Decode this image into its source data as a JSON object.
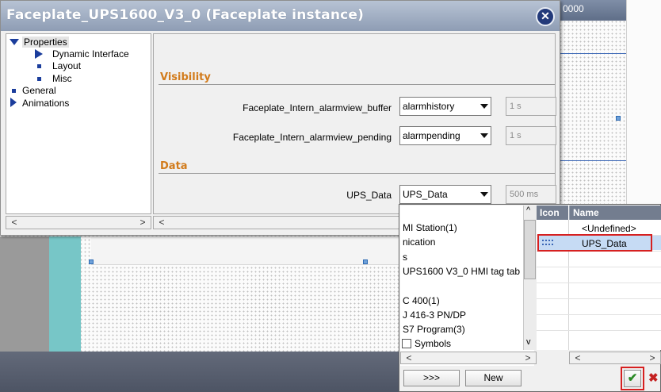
{
  "background": {
    "topright_value": "0000"
  },
  "dialog": {
    "title": "Faceplate_UPS1600_V3_0 (Faceplate instance)",
    "close_icon": "close-x-icon",
    "tree": {
      "properties": "Properties",
      "dynamic_interface": "Dynamic Interface",
      "layout": "Layout",
      "misc": "Misc",
      "general": "General",
      "animations": "Animations"
    },
    "sections": {
      "visibility": "Visibility",
      "data": "Data"
    },
    "params": [
      {
        "label": "Faceplate_Intern_alarmview_buffer",
        "value": "alarmhistory",
        "cycle": "1 s"
      },
      {
        "label": "Faceplate_Intern_alarmview_pending",
        "value": "alarmpending",
        "cycle": "1 s"
      },
      {
        "label": "UPS_Data",
        "value": "UPS_Data",
        "cycle": "500 ms"
      }
    ]
  },
  "popup": {
    "tree_items": [
      "MI Station(1)",
      "nication",
      "s",
      "UPS1600 V3_0 HMI tag tab",
      "C 400(1)",
      "J 416-3 PN/DP",
      "S7 Program(3)",
      "Symbols"
    ],
    "columns": {
      "icon": "Icon",
      "name": "Name"
    },
    "rows": [
      {
        "icon": "",
        "name": "<Undefined>"
      },
      {
        "icon": "tag-icon",
        "name": "UPS_Data"
      }
    ],
    "more_button": ">>>",
    "new_button": "New",
    "ok_icon": "checkmark-icon",
    "cancel_icon": "cancel-x-icon"
  }
}
